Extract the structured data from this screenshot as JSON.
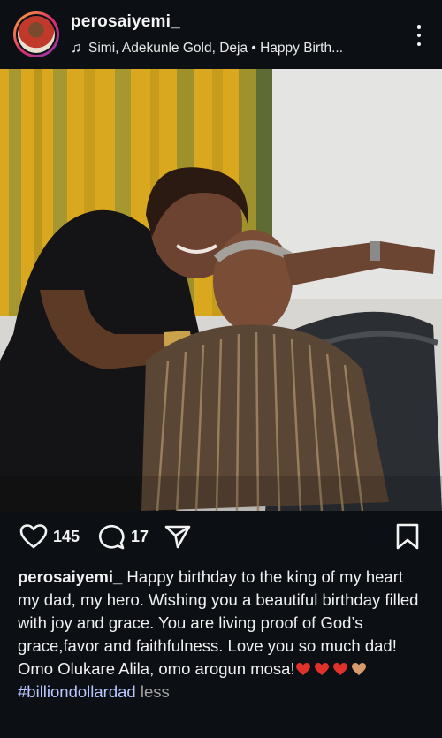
{
  "header": {
    "username": "perosaiyemi_",
    "music": "Simi, Adekunle Gold, Deja • Happy Birth...",
    "menu_icon": "more-vertical-icon"
  },
  "actions": {
    "like_count": "145",
    "comment_count": "17",
    "icons": [
      "heart-icon",
      "comment-icon",
      "share-icon",
      "bookmark-icon"
    ]
  },
  "caption": {
    "username": "perosaiyemi_",
    "text": "Happy birthday to the king of my heart my dad, my hero. Wishing you a beautiful birthday filled with joy and grace. You are living proof of God’s grace,favor and faithfulness. Love you so much dad! Omo Olukare Alila, omo arogun mosa!",
    "hearts": [
      "#e0312b",
      "#e0312b",
      "#e0312b",
      "#d99a6c"
    ],
    "hashtag": "#billiondollardad",
    "less_label": "less"
  },
  "colors": {
    "background": "#0c0f14",
    "hashtag": "#b8c7ff"
  }
}
